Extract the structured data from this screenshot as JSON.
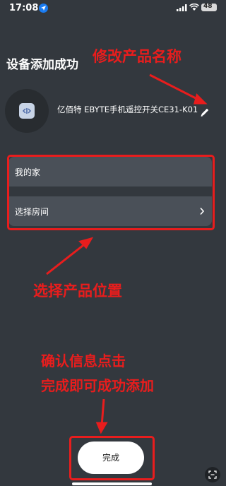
{
  "status_bar": {
    "time": "17:08",
    "battery": "48"
  },
  "page": {
    "title": "设备添加成功"
  },
  "device": {
    "name": "亿佰特 EBYTE手机遥控开关CE31-K01"
  },
  "location": {
    "home_label": "我的家",
    "room_label": "选择房间"
  },
  "actions": {
    "done_label": "完成"
  },
  "annotations": {
    "rename": "修改产品名称",
    "location": "选择产品位置",
    "confirm_line1": "确认信息点击",
    "confirm_line2": "完成即可成功添加"
  },
  "colors": {
    "background": "#33383e",
    "row": "#4a5058",
    "annotation": "#e81d1d",
    "button": "#ffffff"
  }
}
